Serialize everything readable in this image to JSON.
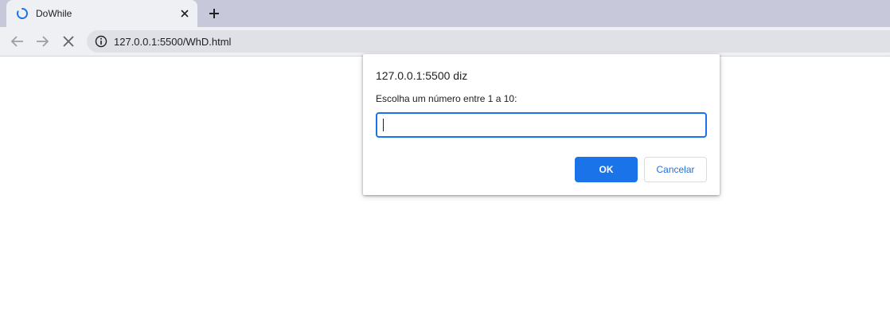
{
  "browser": {
    "tab": {
      "title": "DoWhile",
      "spinner_icon": "loading-spinner-icon",
      "close_icon": "close-icon"
    },
    "new_tab_icon": "plus-icon",
    "toolbar": {
      "back_icon": "back-arrow-icon",
      "forward_icon": "forward-arrow-icon",
      "stop_icon": "stop-icon",
      "info_icon": "info-icon",
      "url": "127.0.0.1:5500/WhD.html"
    }
  },
  "dialog": {
    "title": "127.0.0.1:5500 diz",
    "message": "Escolha um número entre 1 a 10:",
    "input_value": "",
    "ok_label": "OK",
    "cancel_label": "Cancelar"
  },
  "colors": {
    "accent": "#1a73e8",
    "tabstrip": "#c7c9da",
    "toolbar": "#eef0f3",
    "omnibox": "#dfe1e6"
  }
}
